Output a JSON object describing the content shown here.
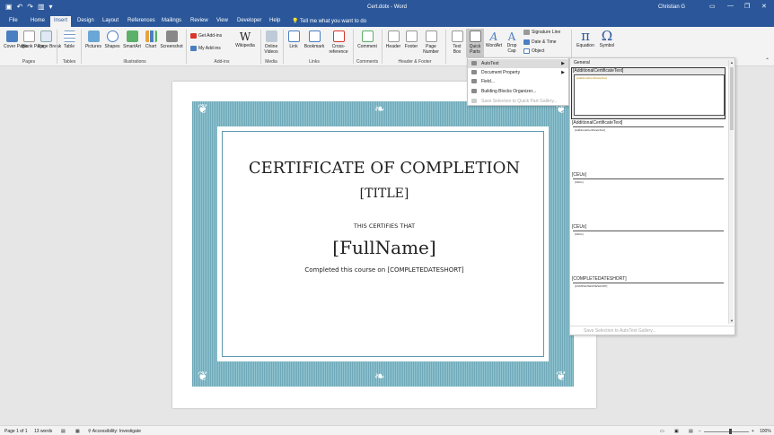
{
  "window": {
    "title": "Cert.dotx - Word",
    "user": "Christian G",
    "minimize": "—",
    "restore": "❐",
    "close": "✕"
  },
  "tabs": [
    {
      "label": "File"
    },
    {
      "label": "Home"
    },
    {
      "label": "Insert"
    },
    {
      "label": "Design"
    },
    {
      "label": "Layout"
    },
    {
      "label": "References"
    },
    {
      "label": "Mailings"
    },
    {
      "label": "Review"
    },
    {
      "label": "View"
    },
    {
      "label": "Developer"
    },
    {
      "label": "Help"
    }
  ],
  "tell_me": "Tell me what you want to do",
  "ribbon": {
    "pages": {
      "cover": "Cover Page",
      "blank": "Blank Page",
      "break": "Page Break",
      "group": "Pages"
    },
    "tables": {
      "table": "Table",
      "group": "Tables"
    },
    "illustrations": {
      "pictures": "Pictures",
      "shapes": "Shapes",
      "smartart": "SmartArt",
      "chart": "Chart",
      "screenshot": "Screenshot",
      "group": "Illustrations"
    },
    "addins": {
      "get": "Get Add-ins",
      "my": "My Add-ins",
      "wikipedia": "Wikipedia",
      "group": "Add-ins"
    },
    "media": {
      "online_videos": "Online Videos",
      "group": "Media"
    },
    "links": {
      "link": "Link",
      "bookmark": "Bookmark",
      "crossref": "Cross-reference",
      "group": "Links"
    },
    "comments": {
      "comment": "Comment",
      "group": "Comments"
    },
    "header_footer": {
      "header": "Header",
      "footer": "Footer",
      "page_number": "Page Number",
      "group": "Header & Footer"
    },
    "text": {
      "text_box": "Text Box",
      "quick_parts": "Quick Parts",
      "wordart": "WordArt",
      "drop_cap": "Drop Cap",
      "signature": "Signature Line",
      "datetime": "Date & Time",
      "object": "Object"
    },
    "symbols": {
      "equation": "Equation",
      "symbol": "Symbol"
    }
  },
  "certificate": {
    "title": "CERTIFICATE OF COMPLETION",
    "subtitle": "[TITLE]",
    "certifies": "THIS CERTIFIES THAT",
    "name": "[FullName]",
    "completed": "Completed this course on [COMPLETEDATESHORT]"
  },
  "quick_parts_menu": [
    {
      "label": "AutoText",
      "submenu": true,
      "highlighted": true,
      "disabled": false
    },
    {
      "label": "Document Property",
      "submenu": true,
      "highlighted": false,
      "disabled": false
    },
    {
      "label": "Field...",
      "submenu": false,
      "highlighted": false,
      "disabled": false
    },
    {
      "label": "Building Blocks Organizer...",
      "submenu": false,
      "highlighted": false,
      "disabled": false
    },
    {
      "label": "Save Selection to Quick Part Gallery...",
      "submenu": false,
      "highlighted": false,
      "disabled": true
    }
  ],
  "autotext_gallery": {
    "header": "General",
    "entries": [
      {
        "title": "[AdditionalCertificateText]",
        "preview": "[AdditionalCertificateText]",
        "selected": true
      },
      {
        "title": "[AdditionalCertificateText]",
        "preview": "[AdditionalCertificateText]",
        "selected": false
      },
      {
        "title": "[CEUs]",
        "preview": "[CEUs]",
        "selected": false
      },
      {
        "title": "[CEUs]",
        "preview": "[CEUs]",
        "selected": false
      },
      {
        "title": "[COMPLETEDATESHORT]",
        "preview": "[COMPLETEDATESHORT]",
        "selected": false
      }
    ],
    "footer": "Save Selection to AutoText Gallery..."
  },
  "status": {
    "page": "Page 1 of 1",
    "words": "13 words",
    "accessibility": "Accessibility: Investigate",
    "zoom": "100%"
  },
  "colors": {
    "word_blue": "#2b579a",
    "cert_teal": "#6fa8b8"
  }
}
